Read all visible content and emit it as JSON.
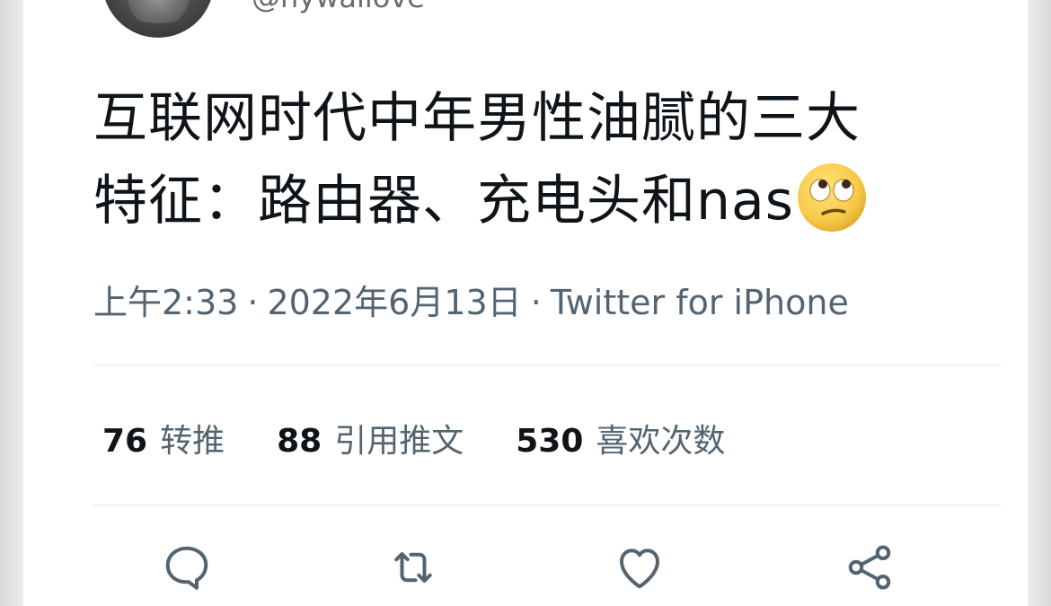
{
  "user": {
    "handle": "@nywallove"
  },
  "tweet": {
    "line1": "互联网时代中年男性油腻的三大",
    "line2": "特征：路由器、充电头和nas",
    "emoji": "face-with-rolling-eyes"
  },
  "meta": {
    "time": "上午2:33",
    "separator": "·",
    "date": "2022年6月13日",
    "source": "Twitter for iPhone"
  },
  "stats": [
    {
      "count": "76",
      "label": "转推"
    },
    {
      "count": "88",
      "label": "引用推文"
    },
    {
      "count": "530",
      "label": "喜欢次数"
    }
  ],
  "actions": {
    "reply_icon": "reply-icon",
    "retweet_icon": "retweet-icon",
    "like_icon": "heart-icon",
    "share_icon": "share-icon"
  },
  "colors": {
    "text": "#0f1419",
    "secondary": "#536471",
    "divider": "#eff3f4",
    "emoji_yellow": "#f7c948"
  }
}
